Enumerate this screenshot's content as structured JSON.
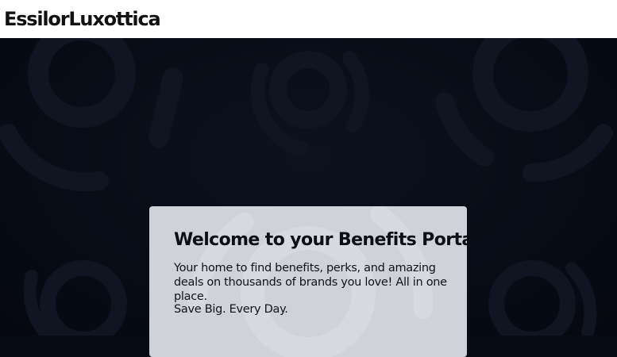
{
  "header": {
    "logo_text": "EssilorLuxottica"
  },
  "welcome_card": {
    "title": "Welcome to your Benefits Portal!",
    "body": "Your home to find benefits, perks, and amazing deals on thousands of brands you love! All in one place.",
    "tagline": "Save Big. Every Day."
  },
  "colors": {
    "header_bg": "#ffffff",
    "hero_bg": "#070b14",
    "card_bg": "#cfd2d9",
    "text": "#0d0f14"
  }
}
